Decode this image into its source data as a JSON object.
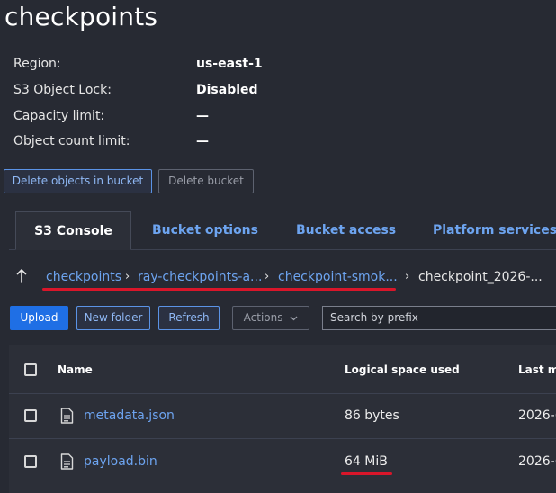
{
  "bucket": {
    "title": "checkpoints",
    "properties": [
      {
        "label": "Region:",
        "value": "us-east-1"
      },
      {
        "label": "S3 Object Lock:",
        "value": "Disabled"
      },
      {
        "label": "Capacity limit:",
        "value": "—"
      },
      {
        "label": "Object count limit:",
        "value": "—"
      }
    ],
    "delete_objects_label": "Delete objects in bucket",
    "delete_bucket_label": "Delete bucket"
  },
  "tabs": [
    {
      "label": "S3 Console",
      "active": true
    },
    {
      "label": "Bucket options",
      "active": false
    },
    {
      "label": "Bucket access",
      "active": false
    },
    {
      "label": "Platform services",
      "active": false
    }
  ],
  "breadcrumb": {
    "up_icon": "arrow-up-icon",
    "items": [
      "checkpoints",
      "ray-checkpoints-a...",
      "checkpoint-smok...",
      "checkpoint_2026-..."
    ],
    "separator": "›"
  },
  "toolbar": {
    "upload_label": "Upload",
    "new_folder_label": "New folder",
    "refresh_label": "Refresh",
    "actions_label": "Actions",
    "search_placeholder": "Search by prefix"
  },
  "table": {
    "columns": [
      "Name",
      "Logical space used",
      "Last m"
    ],
    "rows": [
      {
        "name": "metadata.json",
        "size": "86 bytes",
        "modified": "2026-("
      },
      {
        "name": "payload.bin",
        "size": "64 MiB",
        "modified": "2026-("
      }
    ]
  },
  "colors": {
    "background": "#272a33",
    "link": "#6da4f0",
    "primary": "#1f6fe5",
    "annotation": "#d9162a"
  }
}
